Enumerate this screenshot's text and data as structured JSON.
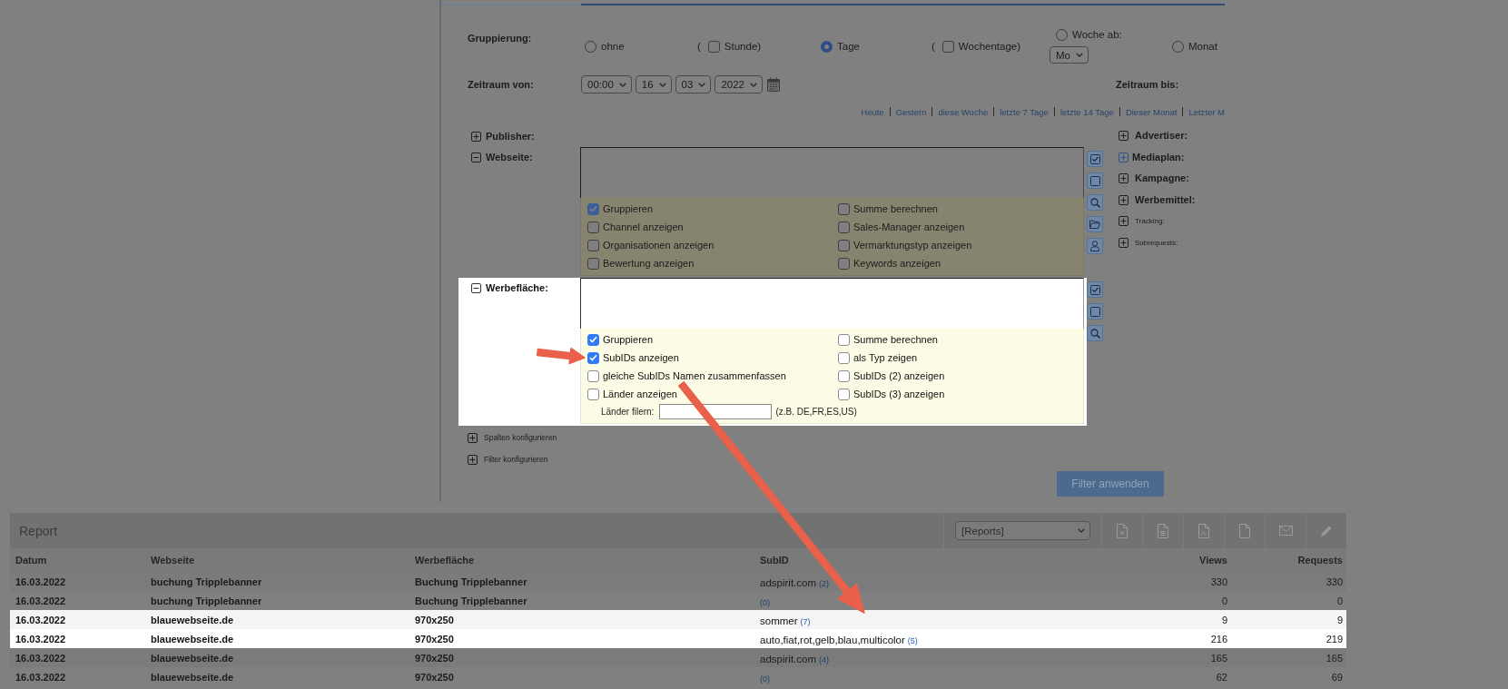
{
  "filter": {
    "grouping": {
      "label": "Gruppierung:",
      "options": [
        {
          "kind": "radio",
          "label": "ohne",
          "selected": false
        },
        {
          "kind": "checkbox",
          "prefix": "(",
          "label": "Stunde)",
          "checked": false
        },
        {
          "kind": "radio",
          "label": "Tage",
          "selected": true
        },
        {
          "kind": "checkbox",
          "prefix": "(",
          "label": "Wochentage)",
          "checked": false
        },
        {
          "kind": "radio",
          "label": "Woche ab:",
          "selected": false,
          "select": "Mo"
        },
        {
          "kind": "radio",
          "label": "Monat",
          "selected": false
        }
      ]
    },
    "period": {
      "from_label": "Zeitraum von:",
      "from_selects": [
        "00:00",
        "16",
        "03",
        "2022"
      ],
      "to_label": "Zeitraum bis:"
    },
    "quick_links": [
      "Heute",
      "Gestern",
      "diese Woche",
      "letzte 7 Tage",
      "letzte 14 Tage",
      "Dieser Monat",
      "Letzter M"
    ],
    "sections": [
      {
        "label": "Publisher:",
        "expanded": false
      },
      {
        "label": "Webseite:",
        "expanded": true,
        "highlighted": false,
        "options": [
          {
            "label": "Gruppieren",
            "checked": true
          },
          {
            "label": "Summe berechnen",
            "checked": false
          },
          {
            "label": "Channel anzeigen",
            "checked": false
          },
          {
            "label": "Sales-Manager anzeigen",
            "checked": false
          },
          {
            "label": "Organisationen anzeigen",
            "checked": false
          },
          {
            "label": "Vermarktungstyp anzeigen",
            "checked": false
          },
          {
            "label": "Bewertung anzeigen",
            "checked": false
          },
          {
            "label": "Keywords anzeigen",
            "checked": false
          }
        ],
        "tools": [
          {
            "kind": "select_all"
          },
          {
            "kind": "select_none"
          },
          {
            "kind": "search"
          },
          {
            "kind": "open"
          },
          {
            "kind": "user"
          }
        ]
      },
      {
        "label": "Werbefläche:",
        "expanded": true,
        "highlighted": true,
        "options": [
          {
            "label": "Gruppieren",
            "checked": true
          },
          {
            "label": "Summe berechnen",
            "checked": false
          },
          {
            "label": "SubIDs anzeigen",
            "checked": true
          },
          {
            "label": "als Typ zeigen",
            "checked": false
          },
          {
            "label": "gleiche SubIDs Namen zusammenfassen",
            "checked": false
          },
          {
            "label": "SubIDs (2) anzeigen",
            "checked": false
          },
          {
            "label": "Länder anzeigen",
            "checked": false
          },
          {
            "label": "SubIDs (3) anzeigen",
            "checked": false
          }
        ],
        "country_filter": {
          "label": "Länder filern:",
          "example": "(z.B. DE,FR,ES,US)"
        },
        "tools": [
          {
            "kind": "select_all"
          },
          {
            "kind": "select_none"
          },
          {
            "kind": "search"
          }
        ]
      }
    ],
    "side_sections": [
      {
        "label": "Advertiser:",
        "expanded": false,
        "kind": "main"
      },
      {
        "label": "Mediaplan:",
        "expanded": false,
        "kind": "accent"
      },
      {
        "label": "Kampagne:",
        "expanded": false,
        "kind": "main"
      },
      {
        "label": "Werbemittel:",
        "expanded": false,
        "kind": "main"
      },
      {
        "label": "Tracking:",
        "expanded": false,
        "kind": "sub"
      },
      {
        "label": "Subrequests:",
        "expanded": false,
        "kind": "sub"
      }
    ],
    "extras": [
      {
        "label": "Spalten konfigurieren",
        "expanded": false
      },
      {
        "label": "Filter konfigurieren",
        "expanded": false
      }
    ],
    "apply_button": "Filter anwenden"
  },
  "report": {
    "title": "Report",
    "view_select": "[Reports]",
    "actions": [
      {
        "kind": "spreadsheet"
      },
      {
        "kind": "document"
      },
      {
        "kind": "pdf"
      },
      {
        "kind": "file"
      },
      {
        "kind": "mail"
      },
      {
        "kind": "edit"
      }
    ],
    "columns": [
      "Datum",
      "Webseite",
      "Werbefläche",
      "SubID",
      "Views",
      "Requests"
    ],
    "rows": [
      {
        "highlighted": false,
        "date": "16.03.2022",
        "website": "buchung Tripplebanner",
        "ad_space": "Buchung Tripplebanner",
        "subid": [
          {
            "kind": "text",
            "value": "adspirit.com"
          },
          {
            "kind": "count",
            "value": "(2)"
          }
        ],
        "views": "330",
        "requests": "330"
      },
      {
        "highlighted": false,
        "date": "16.03.2022",
        "website": "buchung Tripplebanner",
        "ad_space": "Buchung Tripplebanner",
        "subid": [
          {
            "kind": "count",
            "value": "(0)"
          }
        ],
        "views": "0",
        "requests": "0"
      },
      {
        "highlighted": true,
        "date": "16.03.2022",
        "website": "blauewebseite.de",
        "ad_space": "970x250",
        "subid": [
          {
            "kind": "text",
            "value": "sommer"
          },
          {
            "kind": "count",
            "value": "(7)"
          }
        ],
        "views": "9",
        "requests": "9"
      },
      {
        "highlighted": true,
        "date": "16.03.2022",
        "website": "blauewebseite.de",
        "ad_space": "970x250",
        "subid": [
          {
            "kind": "text",
            "value": "auto,fiat,rot,gelb,blau,multicolor"
          },
          {
            "kind": "count",
            "value": "(5)"
          }
        ],
        "views": "216",
        "requests": "219"
      },
      {
        "highlighted": false,
        "date": "16.03.2022",
        "website": "blauewebseite.de",
        "ad_space": "970x250",
        "subid": [
          {
            "kind": "text",
            "value": "adspirit.com"
          },
          {
            "kind": "count",
            "value": "(4)"
          }
        ],
        "views": "165",
        "requests": "165"
      },
      {
        "highlighted": false,
        "date": "16.03.2022",
        "website": "blauewebseite.de",
        "ad_space": "970x250",
        "subid": [
          {
            "kind": "count",
            "value": "(0)"
          }
        ],
        "views": "62",
        "requests": "69"
      }
    ]
  }
}
